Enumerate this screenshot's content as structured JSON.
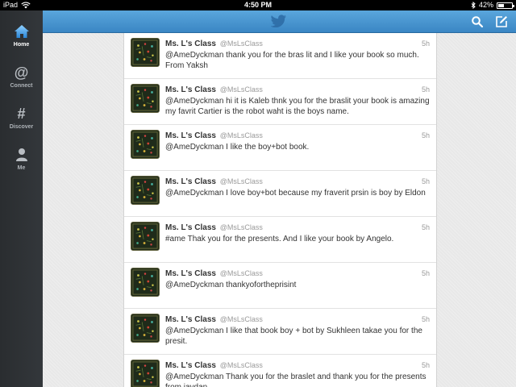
{
  "status": {
    "device": "iPad",
    "time": "4:50 PM",
    "battery": "42%",
    "battery_level": 0.42
  },
  "sidebar": {
    "items": [
      {
        "label": "Home",
        "icon": "home-icon",
        "active": true
      },
      {
        "label": "Connect",
        "icon": "at-icon",
        "active": false
      },
      {
        "label": "Discover",
        "icon": "hash-icon",
        "active": false
      },
      {
        "label": "Me",
        "icon": "person-icon",
        "active": false
      }
    ]
  },
  "topbar": {
    "logo": "twitter-bird-icon",
    "search_icon": "search-icon",
    "compose_icon": "compose-icon",
    "color": "#4a96d2"
  },
  "tweets": [
    {
      "name": "Ms. L's Class",
      "handle": "@MsLsClass",
      "time": "5h",
      "text": "@AmeDyckman thank you for the bras lit and I like your book so much. From Yaksh"
    },
    {
      "name": "Ms. L's Class",
      "handle": "@MsLsClass",
      "time": "5h",
      "text": "@AmeDyckman hi it is Kaleb thnk you for the braslit your book is amazing my favrit Cartier is the robot  waht is the boys name."
    },
    {
      "name": "Ms. L's Class",
      "handle": "@MsLsClass",
      "time": "5h",
      "text": "@AmeDyckman I like the boy+bot book."
    },
    {
      "name": "Ms. L's Class",
      "handle": "@MsLsClass",
      "time": "5h",
      "text": "@AmeDyckman I love boy+bot because my fraverit prsin is boy by Eldon"
    },
    {
      "name": "Ms. L's Class",
      "handle": "@MsLsClass",
      "time": "5h",
      "text": "#ame Thak you for the presents. And I like your book by Angelo."
    },
    {
      "name": "Ms. L's Class",
      "handle": "@MsLsClass",
      "time": "5h",
      "text": "@AmeDyckman thankyofortheprisint"
    },
    {
      "name": "Ms. L's Class",
      "handle": "@MsLsClass",
      "time": "5h",
      "text": "@AmeDyckman  I like  that book boy + bot by Sukhleen takae you for the presit."
    },
    {
      "name": "Ms. L's Class",
      "handle": "@MsLsClass",
      "time": "5h",
      "text": "@AmeDyckman  Thank you  for the braslet and thank you for the presents from  jaydan"
    }
  ]
}
